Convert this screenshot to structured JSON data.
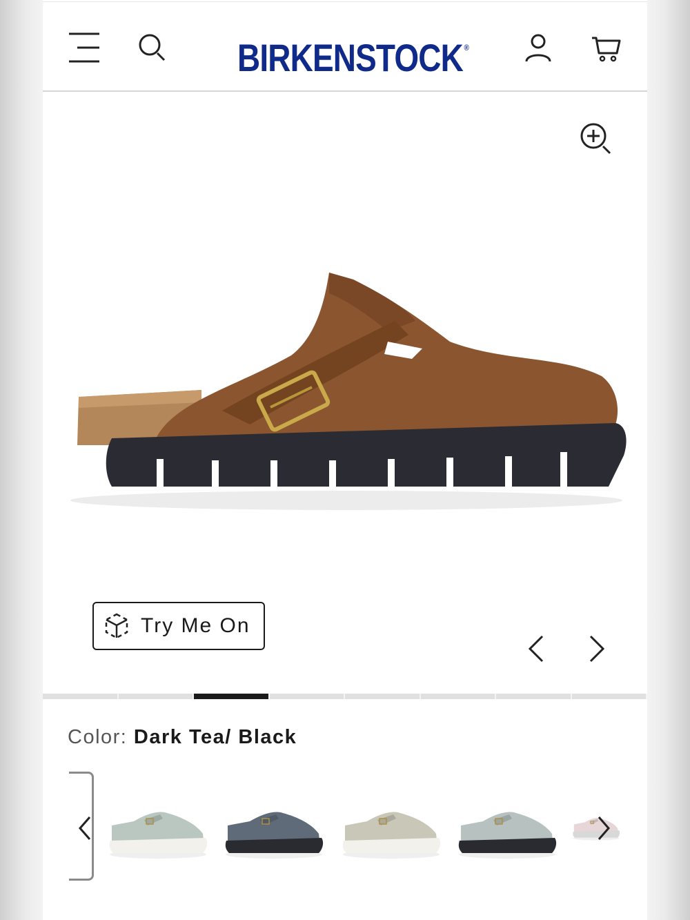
{
  "header": {
    "brand": "BIRKENSTOCK",
    "brand_mark": "®",
    "icons": [
      "menu-icon",
      "search-icon",
      "account-icon",
      "cart-icon"
    ],
    "brand_color": "#102a8a"
  },
  "gallery": {
    "zoom_icon": "zoom-in-icon",
    "try_on_label": "Try Me On",
    "slide_count": 8,
    "active_slide": 3,
    "product_color": "#8b5530",
    "sole_color": "#2b2c33"
  },
  "product": {
    "color_label": "Color:",
    "color_value": "Dark Tea/ Black"
  },
  "swatches": [
    {
      "upper": "#b9c7c0",
      "sole": "#f3f1ec"
    },
    {
      "upper": "#5f6b78",
      "sole": "#2a2b30"
    },
    {
      "upper": "#c9c7b7",
      "sole": "#f3f1ec"
    },
    {
      "upper": "#b7c2c0",
      "sole": "#2a2b30"
    },
    {
      "upper": "#e6d6d8",
      "sole": "#d8d8d8"
    }
  ]
}
